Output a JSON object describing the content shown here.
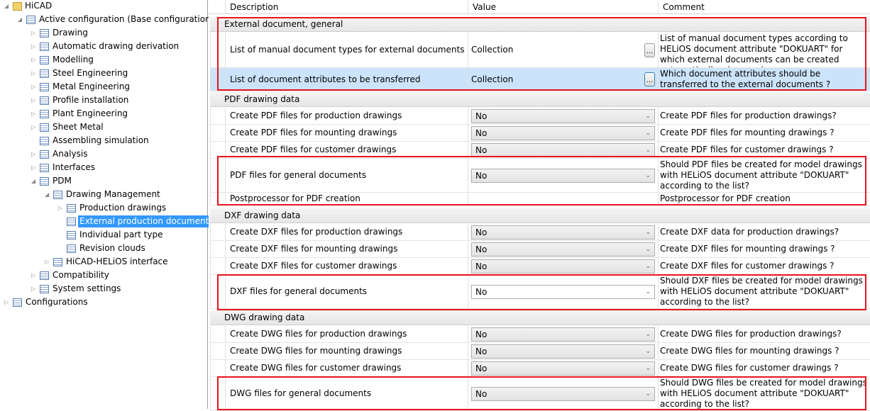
{
  "tree": [
    {
      "label": "HiCAD",
      "level": 0,
      "expanded": true,
      "icon": "folder-icon"
    },
    {
      "label": "Active configuration (Base configuration)",
      "level": 1,
      "expanded": true,
      "icon": "list-icon"
    },
    {
      "label": "Drawing",
      "level": 2,
      "expandable": true
    },
    {
      "label": "Automatic drawing derivation",
      "level": 2,
      "expandable": true
    },
    {
      "label": "Modelling",
      "level": 2,
      "expandable": true
    },
    {
      "label": "Steel Engineering",
      "level": 2,
      "expandable": true
    },
    {
      "label": "Metal Engineering",
      "level": 2,
      "expandable": true
    },
    {
      "label": "Profile installation",
      "level": 2,
      "expandable": true
    },
    {
      "label": "Plant Engineering",
      "level": 2,
      "expandable": true
    },
    {
      "label": "Sheet Metal",
      "level": 2,
      "expandable": true
    },
    {
      "label": "Assembling simulation",
      "level": 2,
      "expandable": false
    },
    {
      "label": "Analysis",
      "level": 2,
      "expandable": true
    },
    {
      "label": "Interfaces",
      "level": 2,
      "expandable": true
    },
    {
      "label": "PDM",
      "level": 2,
      "expanded": true
    },
    {
      "label": "Drawing Management",
      "level": 3,
      "expanded": true
    },
    {
      "label": "Production drawings",
      "level": 4,
      "expandable": true
    },
    {
      "label": "External production documents",
      "level": 4,
      "selected": true
    },
    {
      "label": "Individual part type",
      "level": 4
    },
    {
      "label": "Revision clouds",
      "level": 4
    },
    {
      "label": "HiCAD-HELiOS interface",
      "level": 3,
      "expandable": true
    },
    {
      "label": "Compatibility",
      "level": 2,
      "expandable": true
    },
    {
      "label": "System settings",
      "level": 2,
      "expandable": true
    },
    {
      "label": "Configurations",
      "level": 0,
      "expandable": true,
      "icon": "list-icon"
    }
  ],
  "grid": {
    "headers": [
      "Description",
      "Value",
      "Comment"
    ],
    "groups": [
      {
        "title": "External document, general",
        "rows": [
          {
            "desc": "List of manual document types for external documents",
            "value": "Collection",
            "type": "collection",
            "comment": "List of manual document types according to HELiOS document attribute \"DOKUART\" for which external documents can be created automatically when saving"
          },
          {
            "desc": "List of document attributes to be transferred",
            "value": "Collection",
            "type": "collection",
            "selected": true,
            "comment": "Which document attributes should be transferred to the external documents ?"
          }
        ]
      },
      {
        "title": "PDF drawing data",
        "rows": [
          {
            "desc": "Create PDF files for production drawings",
            "value": "No",
            "type": "combo",
            "comment": "Create PDF files for production drawings?"
          },
          {
            "desc": "Create PDF files for mounting drawings",
            "value": "No",
            "type": "combo",
            "comment": "Create PDF files for mounting drawings ?"
          },
          {
            "desc": "Create PDF files for customer drawings",
            "value": "No",
            "type": "combo",
            "comment": "Create PDF files for customer drawings ?"
          },
          {
            "desc": "PDF files for general documents",
            "value": "No",
            "type": "combo",
            "comment": "Should PDF files be created for model drawings with HELiOS document attribute \"DOKUART\" according to the list?"
          },
          {
            "desc": "Postprocessor for PDF creation",
            "value": "",
            "type": "text",
            "comment": "Postprocessor for PDF creation"
          }
        ]
      },
      {
        "title": "DXF drawing data",
        "rows": [
          {
            "desc": "Create DXF files for production drawings",
            "value": "No",
            "type": "combo",
            "comment": "Create DXF data for production drawings?"
          },
          {
            "desc": "Create DXF files for mounting drawings",
            "value": "No",
            "type": "combo",
            "comment": "Create DXF files for mounting drawings ?"
          },
          {
            "desc": "Create DXF files for customer drawings",
            "value": "No",
            "type": "combo",
            "comment": "Create DXF files for customer drawings ?"
          },
          {
            "desc": "DXF files for general documents",
            "value": "No",
            "type": "combo",
            "white": true,
            "comment": "Should DXF files be created for model drawings with HELiOS document attribute \"DOKUART\" according to the list?"
          }
        ]
      },
      {
        "title": "DWG drawing data",
        "rows": [
          {
            "desc": "Create DWG files for production drawings",
            "value": "No",
            "type": "combo",
            "comment": "Create DWG files for production drawings?"
          },
          {
            "desc": "Create DWG files for mounting drawings",
            "value": "No",
            "type": "combo",
            "comment": "Create DWG files for mounting drawings ?"
          },
          {
            "desc": "Create DWG files for customer drawings",
            "value": "No",
            "type": "combo",
            "comment": "Create DWG files for customer drawings ?"
          },
          {
            "desc": "DWG files for general documents",
            "value": "No",
            "type": "combo",
            "comment": "Should DWG files be created for model drawings with HELiOS document attribute \"DOKUART\" according to the list?"
          }
        ]
      }
    ],
    "ellipsis_label": "...",
    "highlight_color": "#e8141c"
  }
}
